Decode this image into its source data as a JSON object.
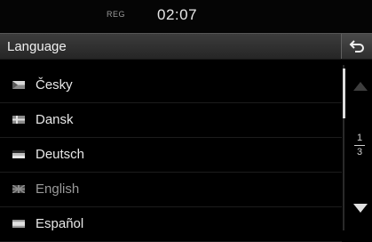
{
  "status": {
    "signal_label": "REG",
    "time": "02:07"
  },
  "header": {
    "title": "Language",
    "back_icon": "back-arrow-icon"
  },
  "languages": [
    {
      "label": "Česky",
      "flag_icon": "flag-czech-icon"
    },
    {
      "label": "Dansk",
      "flag_icon": "flag-denmark-icon"
    },
    {
      "label": "Deutsch",
      "flag_icon": "flag-germany-icon"
    },
    {
      "label": "English",
      "flag_icon": "flag-uk-icon",
      "state": "dimmed"
    },
    {
      "label": "Español",
      "flag_icon": "flag-spain-icon"
    }
  ],
  "pagination": {
    "current": "1",
    "total": "3"
  }
}
